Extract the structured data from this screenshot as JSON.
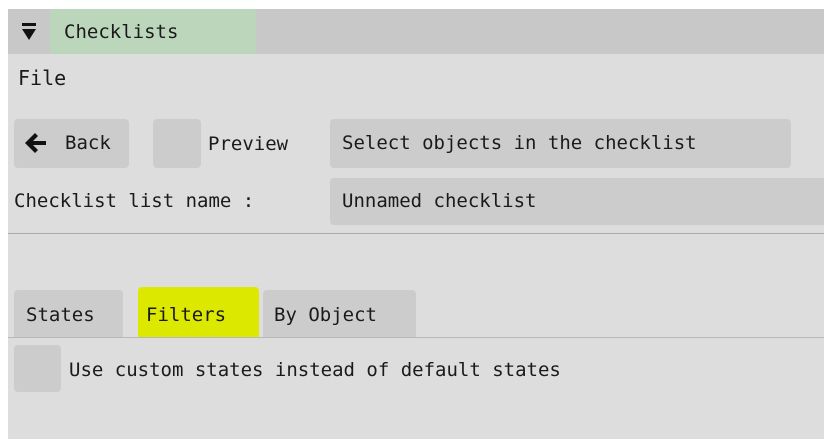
{
  "window": {
    "title": "Checklists",
    "collapse_icon": "triangle-down-icon"
  },
  "menu": {
    "file": "File"
  },
  "toolbar": {
    "back_label": "Back",
    "back_icon": "arrow-left-icon",
    "preview_label": "Preview",
    "preview_checked": false,
    "select_label": "Select objects in the checklist"
  },
  "name": {
    "label": "Checklist list name :",
    "value": "Unnamed checklist"
  },
  "tabs": [
    {
      "label": "States",
      "active": false
    },
    {
      "label": "Filters",
      "active": true
    },
    {
      "label": "By Object",
      "active": false
    }
  ],
  "options": {
    "custom_states_label": "Use custom states instead of default states",
    "custom_states_checked": false
  },
  "colors": {
    "panel_bg": "#dddddd",
    "title_bar_bg": "#c8c8c8",
    "title_tab_bg": "#bcd6bc",
    "control_bg": "#cccccc",
    "active_tab_highlight": "#dde800"
  }
}
